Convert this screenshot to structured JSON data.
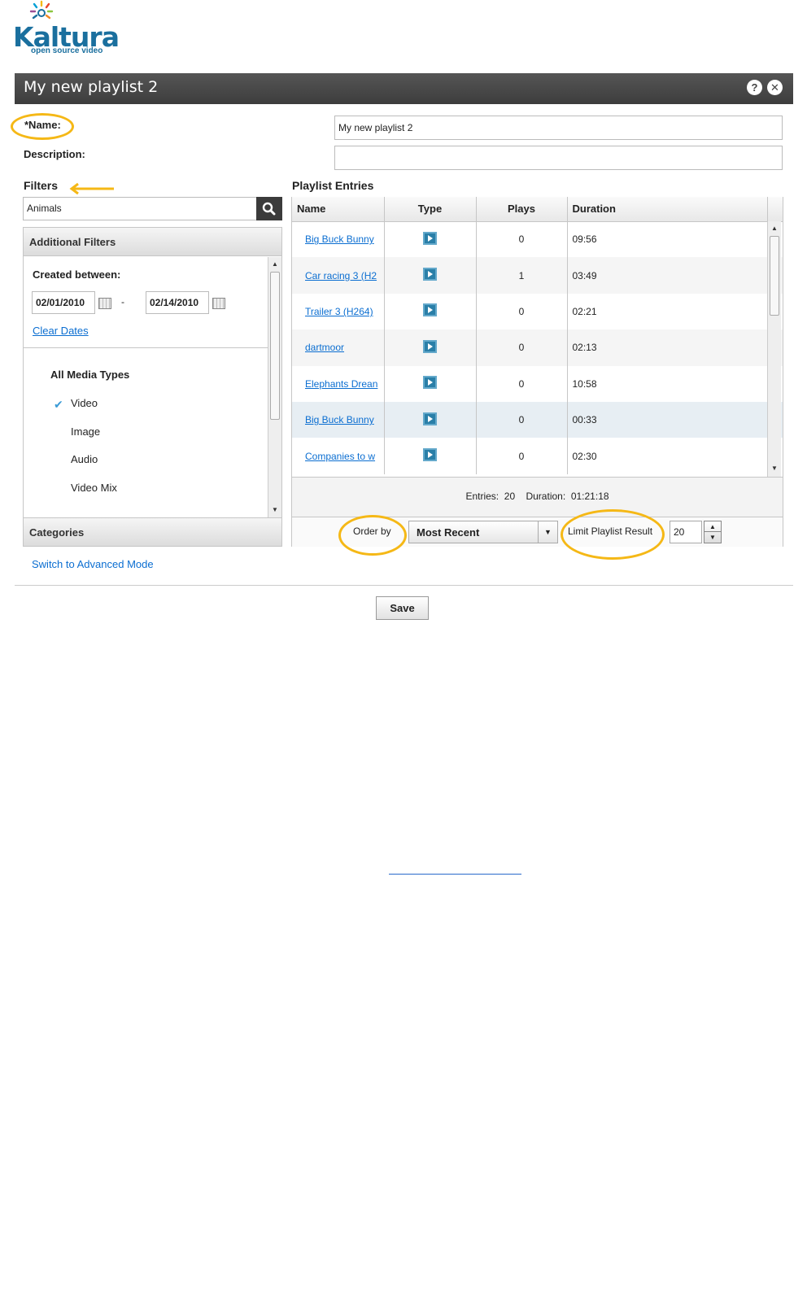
{
  "logo": {
    "name": "Kaltura",
    "tagline": "open source video"
  },
  "window": {
    "title": "My new playlist 2",
    "help_icon": "help-icon",
    "close_icon": "close-icon"
  },
  "form": {
    "name_label": "*Name:",
    "name_value": "My new playlist 2",
    "description_label": "Description:",
    "description_value": ""
  },
  "filters": {
    "title": "Filters",
    "search_value": "Animals",
    "additional_title": "Additional Filters",
    "created_between_label": "Created between:",
    "date_from": "02/01/2010",
    "date_separator": "-",
    "date_to": "02/14/2010",
    "clear_dates": "Clear Dates",
    "media_types_title": "All Media Types",
    "media_types": [
      {
        "label": "Video",
        "checked": true
      },
      {
        "label": "Image",
        "checked": false
      },
      {
        "label": "Audio",
        "checked": false
      },
      {
        "label": "Video Mix",
        "checked": false
      }
    ],
    "categories_title": "Categories",
    "advanced_link": "Switch to Advanced Mode"
  },
  "playlist": {
    "title": "Playlist Entries",
    "columns": [
      "Name",
      "Type",
      "Plays",
      "Duration"
    ],
    "rows": [
      {
        "name": "Big Buck Bunny",
        "plays": "0",
        "duration": "09:56"
      },
      {
        "name": "Car racing 3 (H2",
        "plays": "1",
        "duration": "03:49"
      },
      {
        "name": "Trailer 3 (H264)",
        "plays": "0",
        "duration": "02:21"
      },
      {
        "name": "dartmoor",
        "plays": "0",
        "duration": "02:13"
      },
      {
        "name": "Elephants Drean",
        "plays": "0",
        "duration": "10:58"
      },
      {
        "name": "Big Buck Bunny",
        "plays": "0",
        "duration": "00:33"
      },
      {
        "name": "Companies to w",
        "plays": "0",
        "duration": "02:30"
      }
    ],
    "selected_row": 5,
    "summary": "Entries:  20    Duration:  01:21:18",
    "order_by_label": "Order by",
    "order_by_value": "Most Recent",
    "limit_label": "Limit Playlist Result",
    "limit_value": "20"
  },
  "save_label": "Save",
  "highlight_color": "#f5b816",
  "accent_color": "#0b6ed1"
}
